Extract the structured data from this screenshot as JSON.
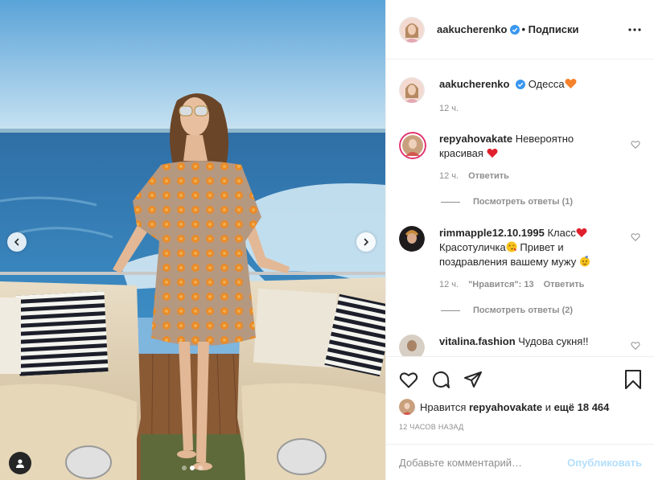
{
  "post": {
    "author": "aakucherenko",
    "follow_label": "• Подписки"
  },
  "icons": {
    "verified": "verified-badge-icon",
    "more": "more-options-icon",
    "like": "heart-icon",
    "comment": "comment-icon",
    "share": "paper-plane-icon",
    "save": "bookmark-icon",
    "tag": "user-tag-icon",
    "prev": "chevron-left-icon",
    "next": "chevron-right-icon"
  },
  "caption": {
    "username": "aakucherenko",
    "text": "Одесса",
    "time": "12 ч."
  },
  "comments": [
    {
      "username": "repyahovakate",
      "text": "Невероятно красивая",
      "time": "12 ч.",
      "reply_label": "Ответить",
      "view_replies": "Посмотреть ответы (1)"
    },
    {
      "username": "rimmapple12.10.1995",
      "text_part1": "Класс",
      "text_part2": "Красотуличка",
      "text_part3": "Привет и поздравления вашему мужу",
      "time": "12 ч.",
      "likes_label": "\"Нравится\": 13",
      "reply_label": "Ответить",
      "view_replies": "Посмотреть ответы (2)"
    },
    {
      "username": "vitalina.fashion",
      "text": "Чудова сукня!!"
    }
  ],
  "likes": {
    "prefix": "Нравится",
    "user": "repyahovakate",
    "middle": "и",
    "others": "ещё 18 464"
  },
  "timestamp": "12 ЧАСОВ НАЗАД",
  "composer": {
    "placeholder": "Добавьте комментарий…",
    "publish_label": "Опубликовать"
  },
  "carousel": {
    "slide_count": 3,
    "active_index": 1
  },
  "colors": {
    "accent_blue": "#0095f6",
    "publish_disabled": "#b2dffc",
    "heart_red": "#ed4956",
    "verified_blue": "#3897f0"
  }
}
